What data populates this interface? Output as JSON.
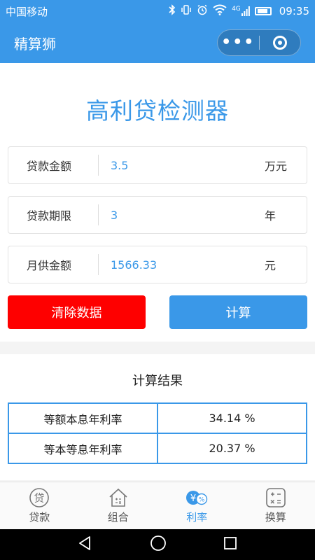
{
  "status_bar": {
    "carrier": "中国移动",
    "time": "09:35",
    "network": "4G"
  },
  "nav": {
    "title": "精算狮",
    "more_label": "•••"
  },
  "page": {
    "title": "高利贷检测器"
  },
  "fields": [
    {
      "label": "贷款金额",
      "value": "3.5",
      "unit": "万元"
    },
    {
      "label": "贷款期限",
      "value": "3",
      "unit": "年"
    },
    {
      "label": "月供金额",
      "value": "1566.33",
      "unit": "元"
    }
  ],
  "buttons": {
    "clear_label": "清除数据",
    "calc_label": "计算",
    "clear_color": "#fe0000",
    "calc_color": "#3a98e8"
  },
  "results": {
    "heading": "计算结果",
    "rows": [
      {
        "name": "等额本息年利率",
        "value": "34.14 %"
      },
      {
        "name": "等本等息年利率",
        "value": "20.37 %"
      }
    ]
  },
  "tabs": [
    {
      "label": "贷款",
      "icon": "loan-icon"
    },
    {
      "label": "组合",
      "icon": "house-calculator-icon"
    },
    {
      "label": "利率",
      "icon": "rate-icon",
      "active": true
    },
    {
      "label": "换算",
      "icon": "calculator-icon"
    }
  ],
  "tab_icon_texts": {
    "loan": "贷",
    "rate_yen": "¥",
    "rate_pct": "%"
  },
  "colors": {
    "accent": "#3a98e8",
    "danger": "#fe0000"
  }
}
